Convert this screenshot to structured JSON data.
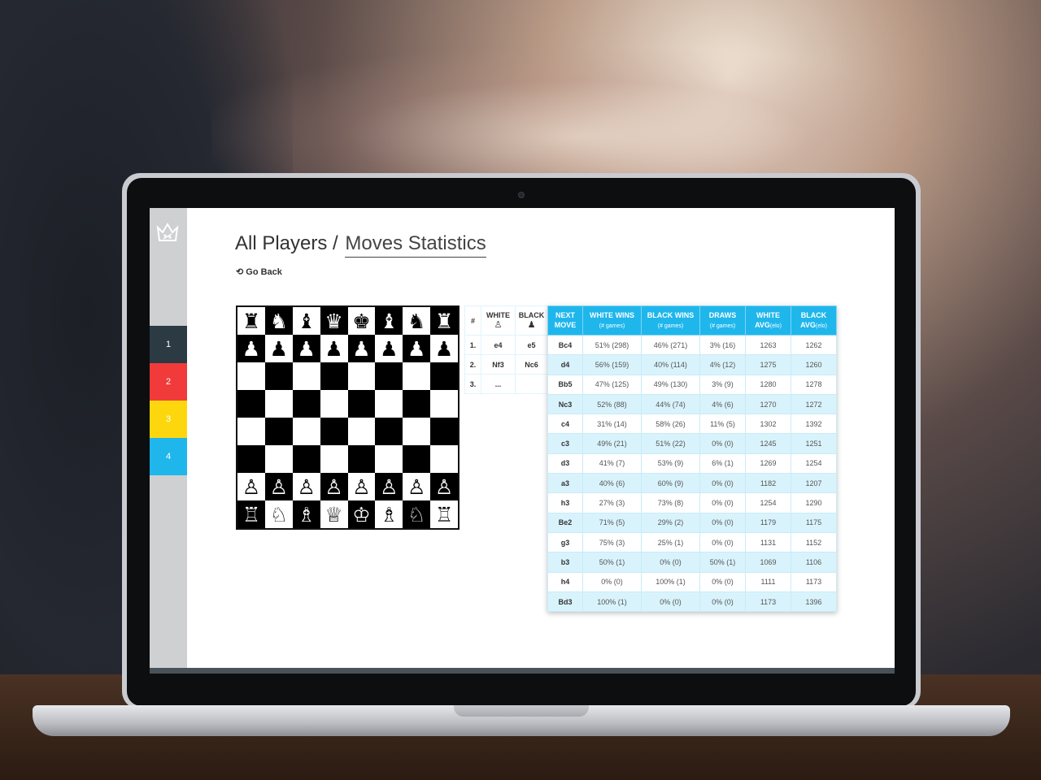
{
  "header": {
    "title": "All Players /",
    "subtitle": "Moves Statistics",
    "go_back": "Go Back"
  },
  "sidebar": {
    "items": [
      {
        "label": "1",
        "color": "#2c3a44"
      },
      {
        "label": "2",
        "color": "#f13b3b"
      },
      {
        "label": "3",
        "color": "#fdd70e"
      },
      {
        "label": "4",
        "color": "#1fb6ec"
      }
    ]
  },
  "board": {
    "ranks": [
      [
        "♜",
        "♞",
        "♝",
        "♛",
        "♚",
        "♝",
        "♞",
        "♜"
      ],
      [
        "♟",
        "♟",
        "♟",
        "♟",
        "♟",
        "♟",
        "♟",
        "♟"
      ],
      [
        "",
        "",
        "",
        "",
        "",
        "",
        "",
        ""
      ],
      [
        "",
        "",
        "",
        "",
        "",
        "",
        "",
        ""
      ],
      [
        "",
        "",
        "",
        "",
        "",
        "",
        "",
        ""
      ],
      [
        "",
        "",
        "",
        "",
        "",
        "",
        "",
        ""
      ],
      [
        "♙",
        "♙",
        "♙",
        "♙",
        "♙",
        "♙",
        "♙",
        "♙"
      ],
      [
        "♖",
        "♘",
        "♗",
        "♕",
        "♔",
        "♗",
        "♘",
        "♖"
      ]
    ]
  },
  "moves": {
    "headers": {
      "num": "#",
      "white": "WHITE",
      "black": "BLACK",
      "white_icon": "♙",
      "black_icon": "♟"
    },
    "rows": [
      {
        "num": "1.",
        "white": "e4",
        "black": "e5"
      },
      {
        "num": "2.",
        "white": "Nf3",
        "black": "Nc6"
      },
      {
        "num": "3.",
        "white": "...",
        "black": ""
      }
    ]
  },
  "stats": {
    "headers": [
      {
        "line1": "NEXT",
        "line2": "MOVE",
        "small": ""
      },
      {
        "line1": "WHITE WINS",
        "line2": "",
        "small": "(# games)"
      },
      {
        "line1": "BLACK WINS",
        "line2": "",
        "small": "(# games)"
      },
      {
        "line1": "DRAWS",
        "line2": "",
        "small": "(# games)"
      },
      {
        "line1": "WHITE",
        "line2": "AVG",
        "small": "(elo)"
      },
      {
        "line1": "BLACK",
        "line2": "AVG",
        "small": "(elo)"
      }
    ],
    "rows": [
      [
        "Bc4",
        "51% (298)",
        "46% (271)",
        "3% (16)",
        "1263",
        "1262"
      ],
      [
        "d4",
        "56% (159)",
        "40% (114)",
        "4% (12)",
        "1275",
        "1260"
      ],
      [
        "Bb5",
        "47% (125)",
        "49% (130)",
        "3% (9)",
        "1280",
        "1278"
      ],
      [
        "Nc3",
        "52% (88)",
        "44% (74)",
        "4% (6)",
        "1270",
        "1272"
      ],
      [
        "c4",
        "31% (14)",
        "58% (26)",
        "11% (5)",
        "1302",
        "1392"
      ],
      [
        "c3",
        "49% (21)",
        "51% (22)",
        "0% (0)",
        "1245",
        "1251"
      ],
      [
        "d3",
        "41% (7)",
        "53% (9)",
        "6% (1)",
        "1269",
        "1254"
      ],
      [
        "a3",
        "40% (6)",
        "60% (9)",
        "0% (0)",
        "1182",
        "1207"
      ],
      [
        "h3",
        "27% (3)",
        "73% (8)",
        "0% (0)",
        "1254",
        "1290"
      ],
      [
        "Be2",
        "71% (5)",
        "29% (2)",
        "0% (0)",
        "1179",
        "1175"
      ],
      [
        "g3",
        "75% (3)",
        "25% (1)",
        "0% (0)",
        "1131",
        "1152"
      ],
      [
        "b3",
        "50% (1)",
        "0% (0)",
        "50% (1)",
        "1069",
        "1106"
      ],
      [
        "h4",
        "0% (0)",
        "100% (1)",
        "0% (0)",
        "1111",
        "1173"
      ],
      [
        "Bd3",
        "100% (1)",
        "0% (0)",
        "0% (0)",
        "1173",
        "1396"
      ]
    ]
  }
}
